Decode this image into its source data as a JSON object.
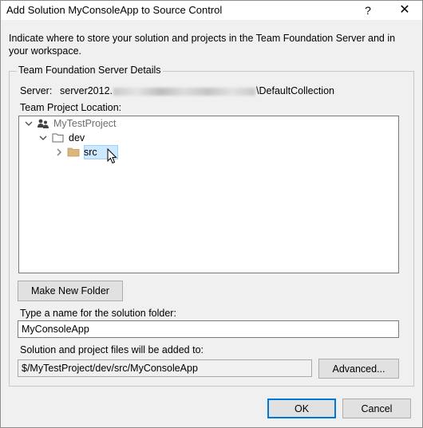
{
  "window": {
    "title": "Add Solution MyConsoleApp to Source Control",
    "help_glyph": "?",
    "close_glyph": "✕"
  },
  "description": "Indicate where to store your solution and projects in the Team Foundation Server and in your workspace.",
  "group": {
    "title": "Team Foundation Server Details",
    "server_label": "Server:",
    "server_prefix": "server2012.",
    "server_suffix": "\\DefaultCollection",
    "project_location_label": "Team Project Location:"
  },
  "tree": {
    "nodes": [
      {
        "label": "MyTestProject",
        "icon": "team-project-icon",
        "expanded": true
      },
      {
        "label": "dev",
        "icon": "folder-icon",
        "expanded": true
      },
      {
        "label": "src",
        "icon": "folder-icon",
        "expanded": false,
        "selected": true
      }
    ]
  },
  "buttons": {
    "make_new_folder": "Make New Folder",
    "advanced": "Advanced...",
    "ok": "OK",
    "cancel": "Cancel"
  },
  "solution_folder": {
    "label": "Type a name for the solution folder:",
    "value": "MyConsoleApp"
  },
  "added_to": {
    "label": "Solution and project files will be added to:",
    "value": "$/MyTestProject/dev/src/MyConsoleApp"
  },
  "colors": {
    "selection_fill": "#cde8ff",
    "selection_border": "#99d1ff",
    "default_button_border": "#0078d7",
    "folder_fill": "#dcb67a"
  }
}
